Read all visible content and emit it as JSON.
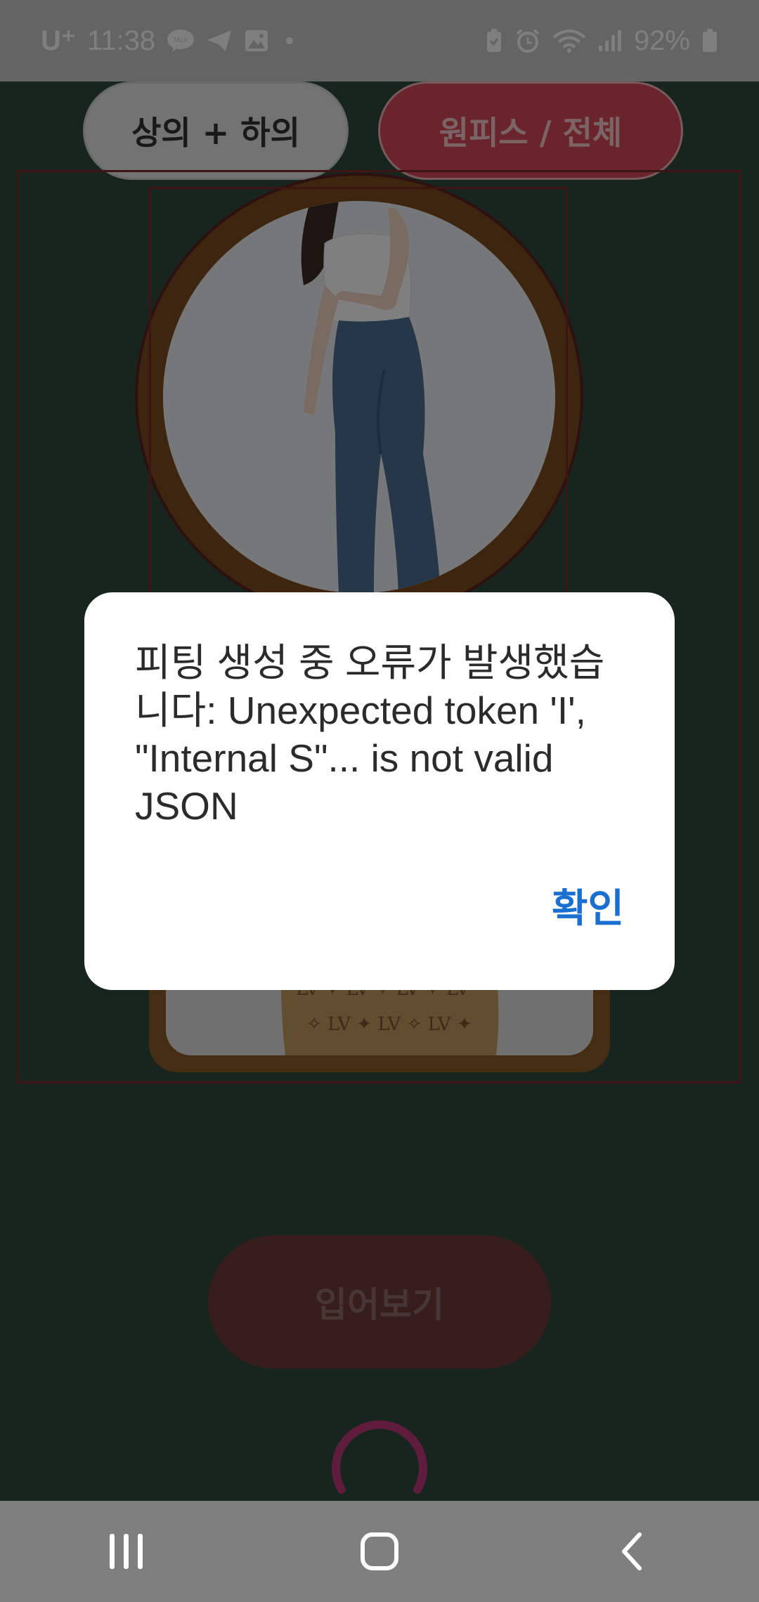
{
  "status_bar": {
    "carrier": "U⁺",
    "time": "11:38",
    "battery": "92%",
    "icons_left": [
      "kakaotalk-icon",
      "telegram-icon",
      "gallery-icon",
      "dot-indicator"
    ],
    "icons_right": [
      "battery-saver-icon",
      "alarm-icon",
      "wifi-icon",
      "signal-icon",
      "battery-icon"
    ]
  },
  "mode_tabs": {
    "top_bottom": "상의 + 하의",
    "one_piece": "원피스 / 전체"
  },
  "try_on_button": "입어보기",
  "dialog": {
    "message": "피팅 생성 중 오류가 발생했습니다: Unexpected token 'I', \"Internal S\"... is not valid JSON",
    "ok_label": "확인"
  },
  "colors": {
    "app_background": "#2f4a3c",
    "accent_red": "#d24b56",
    "frame_brown": "#8a5a28",
    "dialog_button": "#1b6fd1",
    "spinner": "#c0397a"
  },
  "nav": {
    "recent": "recent-apps-icon",
    "home": "home-icon",
    "back": "back-icon"
  }
}
